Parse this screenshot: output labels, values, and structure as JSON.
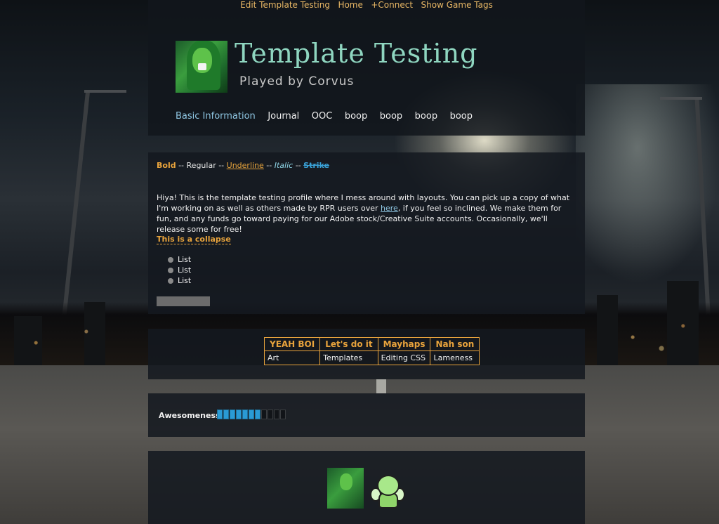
{
  "topnav": {
    "edit": "Edit Template Testing",
    "home": "Home",
    "connect": "+Connect",
    "tags": "Show Game Tags"
  },
  "header": {
    "title": "Template Testing",
    "subtitle": "Played by Corvus",
    "tabs": [
      "Basic Information",
      "Journal",
      "OOC",
      "boop",
      "boop",
      "boop",
      "boop"
    ]
  },
  "formatting": {
    "bold": "Bold",
    "sep1": " -- Regular -- ",
    "underline": "Underline",
    "sep2": " -- ",
    "italic": "Italic",
    "sep3": " -- ",
    "strike": "Strike"
  },
  "intro": {
    "before_link": "Hiya! This is the template testing profile where I mess around with layouts. You can pick up a copy of what I'm working on as well as others made by RPR users over ",
    "link": "here",
    "after_link": ", if you feel so inclined. We make them for fun, and any funds go toward paying for our Adobe stock/Creative Suite accounts. Occasionally, we'll release some for free!"
  },
  "collapse_label": "This is a collapse",
  "list_items": [
    "List",
    "List",
    "List"
  ],
  "table": {
    "headers": [
      "YEAH BOI",
      "Let's do it",
      "Mayhaps",
      "Nah son"
    ],
    "row": [
      "Art",
      "Templates",
      "Editing CSS",
      "Lameness"
    ]
  },
  "meter": {
    "label": "Awesomeness",
    "filled": 7,
    "total": 11
  },
  "colors": {
    "accent": "#e8a33c",
    "link": "#8fc7e3",
    "title": "#8fd6c0",
    "meter": "#2a9bd5"
  },
  "icons": [
    "character-avatar-icon",
    "fairy-sprite-icon"
  ]
}
